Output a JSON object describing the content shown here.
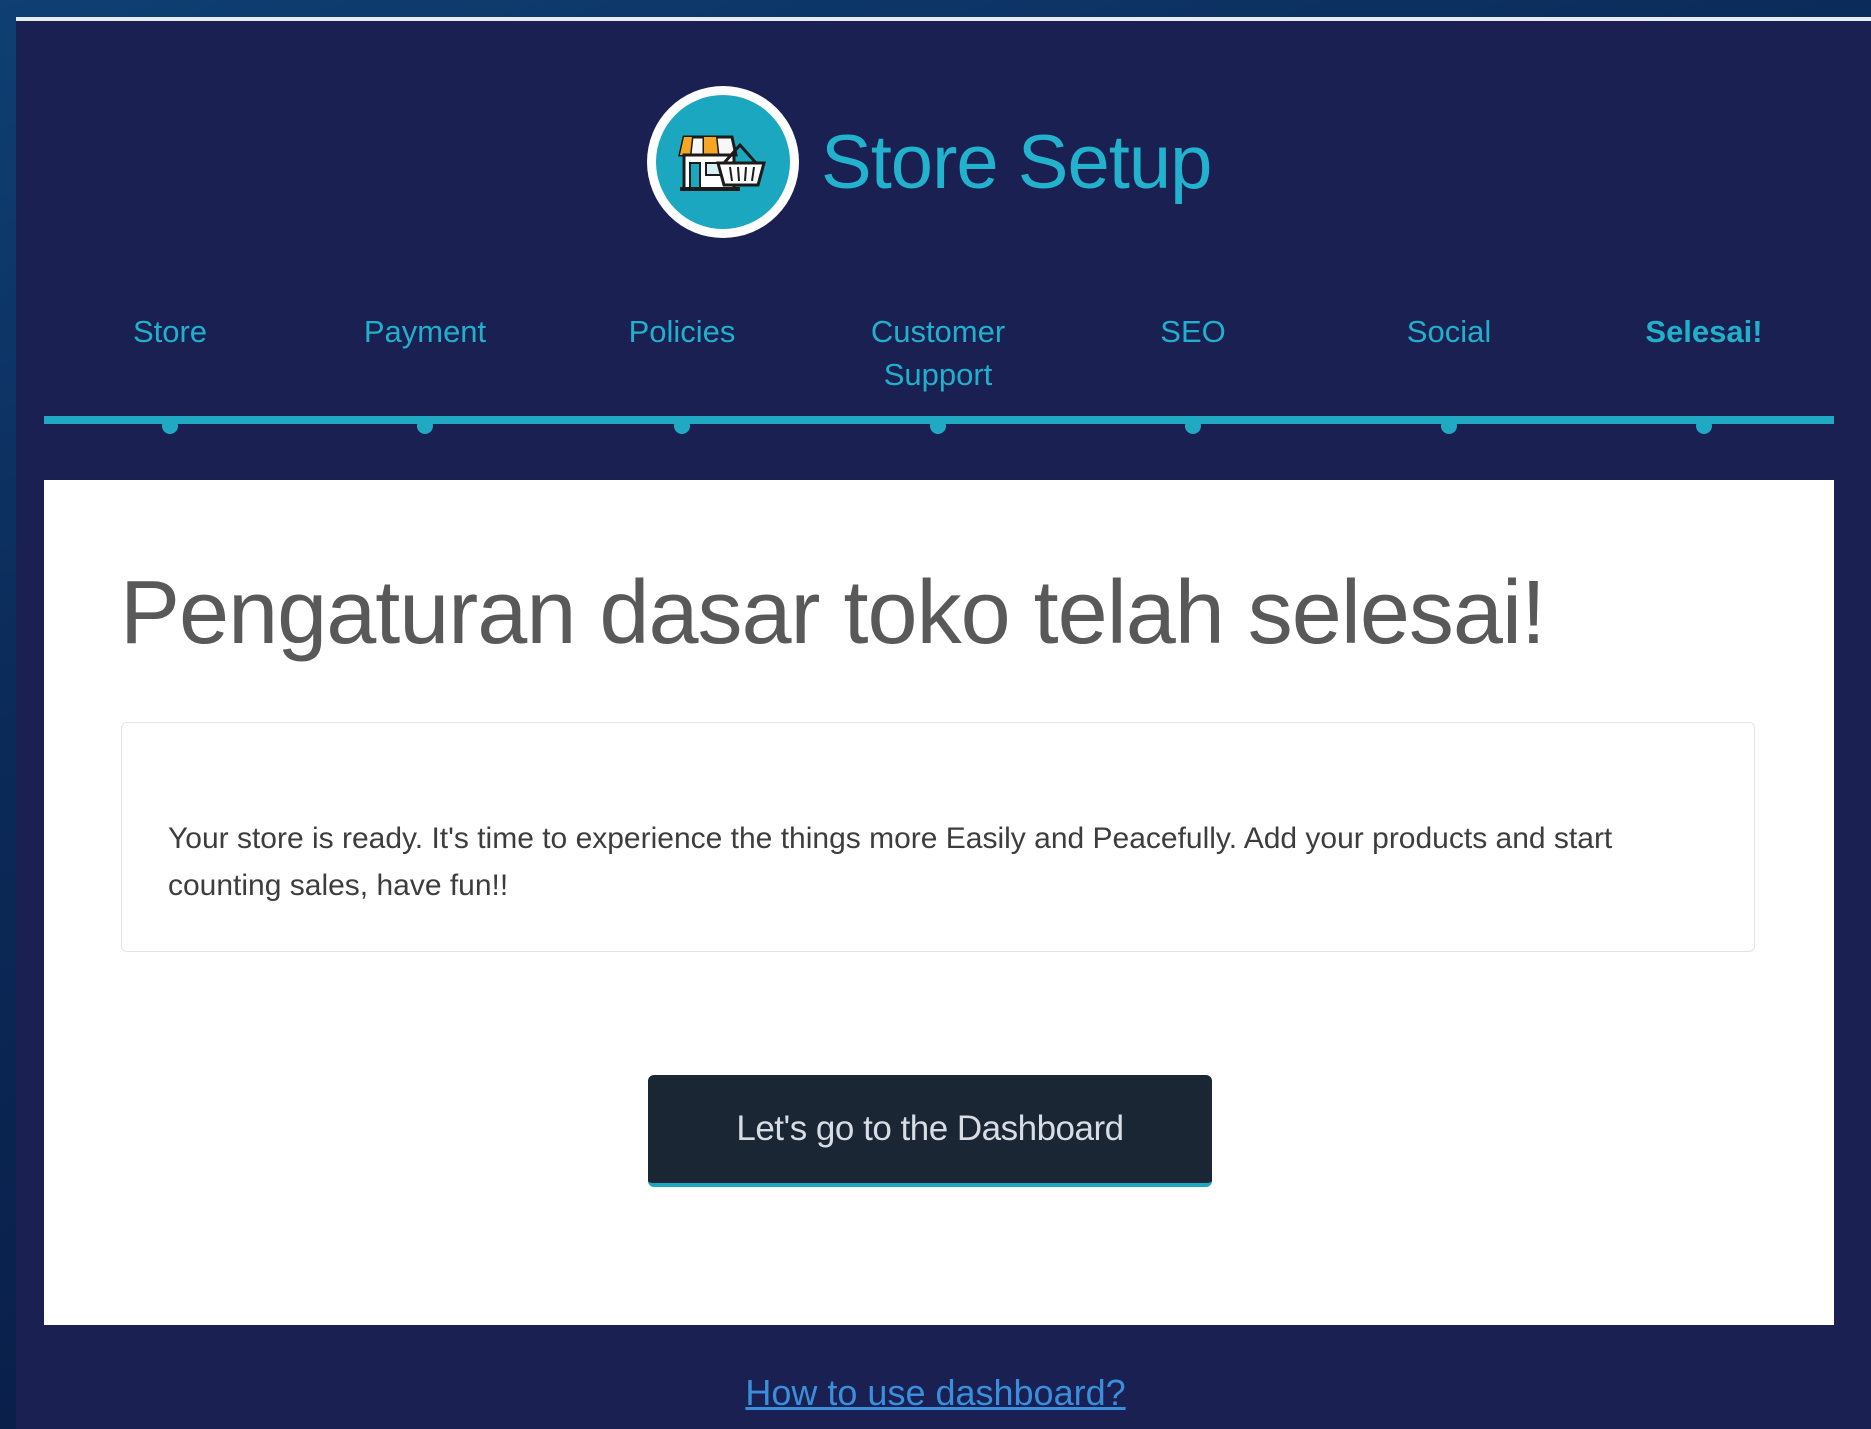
{
  "header": {
    "title": "Store Setup",
    "logo_icon": "store-basket-icon"
  },
  "steps": [
    {
      "label": "Store"
    },
    {
      "label": "Payment"
    },
    {
      "label": "Policies"
    },
    {
      "label": "Customer Support"
    },
    {
      "label": "SEO"
    },
    {
      "label": "Social"
    },
    {
      "label": "Selesai!",
      "active": true
    }
  ],
  "main": {
    "heading": "Pengaturan dasar toko telah selesai!",
    "message": "Your store is ready. It's time to experience the things more Easily and Peacefully. Add your products and start counting sales, have fun!!",
    "cta_label": "Let's go to the Dashboard"
  },
  "footer": {
    "help_link": "How to use dashboard?"
  },
  "colors": {
    "accent": "#22b2cd",
    "frame_bg": "#1a2052",
    "button_bg": "#1b2634",
    "link": "#3a8fdc"
  }
}
